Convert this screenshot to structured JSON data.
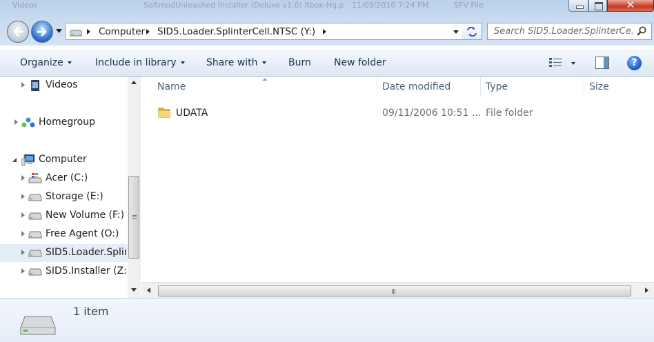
{
  "background_window": {
    "items": [
      "Videos",
      "SoftmodUnleashed Installer (Deluxe v1.0) Xbox-Hq.p",
      "11/09/2010 7:24 PM",
      "SFV File"
    ]
  },
  "window_controls": {
    "minimize": "minimize",
    "maximize": "maximize",
    "close": "✕"
  },
  "address": {
    "crumbs": [
      "Computer",
      "SID5.Loader.SplinterCell.NTSC (Y:)"
    ]
  },
  "search": {
    "placeholder": "Search SID5.Loader.SplinterCe..."
  },
  "toolbar": {
    "organize": "Organize",
    "include_in_library": "Include in library",
    "share_with": "Share with",
    "burn": "Burn",
    "new_folder": "New folder",
    "help": "?"
  },
  "navpane": {
    "items": [
      {
        "label": "Videos",
        "icon": "video-library-icon"
      },
      {
        "label": "Homegroup",
        "icon": "homegroup-icon"
      },
      {
        "label": "Computer",
        "icon": "computer-icon"
      },
      {
        "label": "Acer (C:)",
        "icon": "windows-drive-icon"
      },
      {
        "label": "Storage (E:)",
        "icon": "drive-icon"
      },
      {
        "label": "New Volume (F:)",
        "icon": "drive-icon"
      },
      {
        "label": "Free Agent (O:)",
        "icon": "drive-icon"
      },
      {
        "label": "SID5.Loader.Splin",
        "icon": "drive-icon",
        "selected": true
      },
      {
        "label": "SID5.Installer (Z:)",
        "icon": "drive-icon"
      }
    ]
  },
  "columns": {
    "name": "Name",
    "date_modified": "Date modified",
    "type": "Type",
    "size": "Size"
  },
  "files": [
    {
      "name": "UDATA",
      "date_modified": "09/11/2006 10:51 ...",
      "type": "File folder",
      "size": ""
    }
  ],
  "details": {
    "count": "1 item"
  },
  "colors": {
    "accent": "#1e3050",
    "selected_bg": "#e5eef7",
    "close_red": "#c13a22"
  }
}
